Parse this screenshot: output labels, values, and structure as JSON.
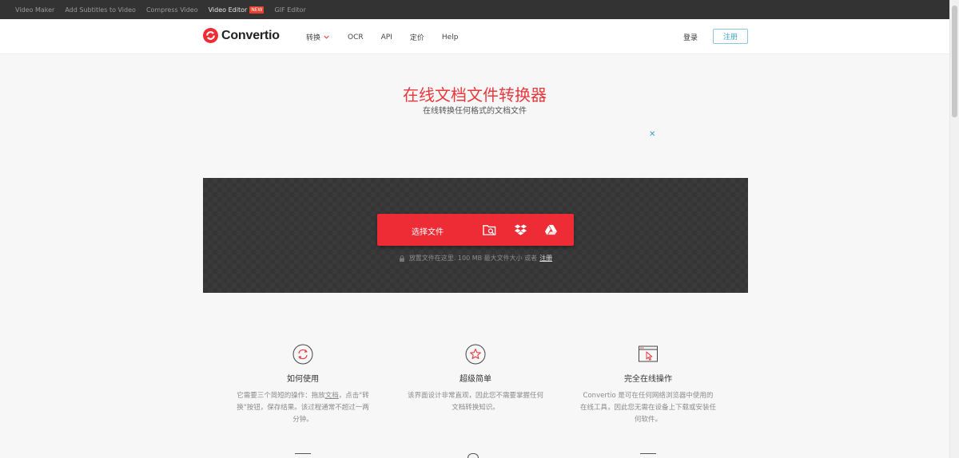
{
  "topbar": {
    "links": [
      "Video Maker",
      "Add Subtitles to Video",
      "Compress Video",
      "Video Editor",
      "GIF Editor"
    ],
    "new_badge": "NEW"
  },
  "header": {
    "logo_text": "Convertio",
    "nav": [
      "转换",
      "OCR",
      "API",
      "定价",
      "Help"
    ],
    "login": "登录",
    "signup": "注册"
  },
  "hero": {
    "title": "在线文档文件转换器",
    "subtitle": "在线转换任何格式的文档文件",
    "ad_close": "✕"
  },
  "upload": {
    "choose_label": "选择文件",
    "note": "放置文件在这里. 100 MB 最大文件大小 或者",
    "note_link": "注册",
    "sources": [
      "folder-search-icon",
      "dropbox-icon",
      "google-drive-icon"
    ]
  },
  "features": [
    {
      "icon": "sync-icon",
      "title": "如何使用",
      "desc_pre": "它需要三个简短的操作：拖放",
      "desc_link": "文档",
      "desc_post": "，点击\"转换\"按钮，保存结果。该过程通常不超过一两分钟。"
    },
    {
      "icon": "star-icon",
      "title": "超级简单",
      "desc": "该界面设计非常直观，因此您不需要掌握任何文档转换知识。"
    },
    {
      "icon": "cursor-window-icon",
      "title": "完全在线操作",
      "desc": "Convertio 是可在任何网络浏览器中使用的在线工具，因此您无需在设备上下载或安装任何软件。"
    }
  ],
  "colors": {
    "accent": "#ee2c35",
    "title_red": "#e8383d",
    "link_blue": "#3ea3c7",
    "topbar": "#333333"
  }
}
